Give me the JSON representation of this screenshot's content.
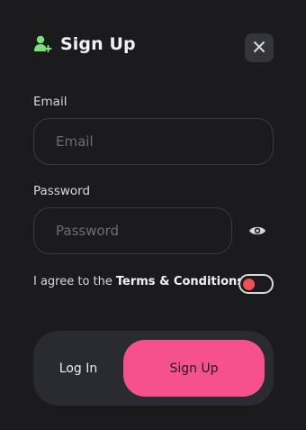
{
  "header": {
    "title": "Sign Up",
    "icon": "user-plus-icon",
    "icon_color": "#7be07a"
  },
  "form": {
    "email_label": "Email",
    "email_placeholder": "Email",
    "email_value": "",
    "password_label": "Password",
    "password_placeholder": "Password",
    "password_value": ""
  },
  "terms": {
    "prefix": "I agree to the",
    "link": "Terms & Conditions",
    "accepted": false
  },
  "actions": {
    "login_label": "Log In",
    "signup_label": "Sign Up"
  },
  "colors": {
    "background": "#1b1b1e",
    "accent": "#f5528b",
    "toggle_knob": "#f0504f",
    "icon_green": "#7be07a"
  }
}
